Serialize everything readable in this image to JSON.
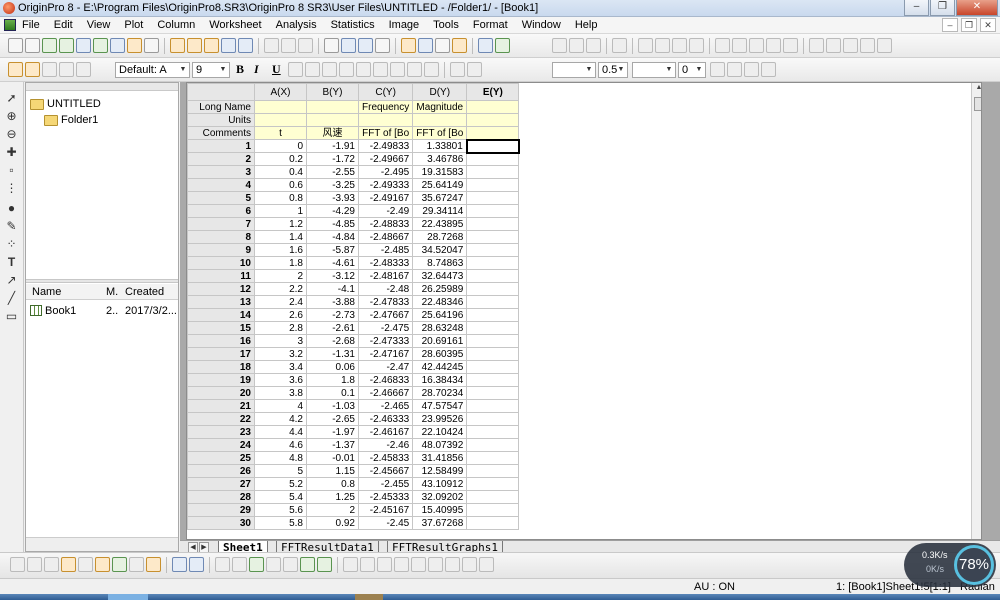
{
  "window": {
    "title": "OriginPro 8 - E:\\Program Files\\OriginPro8.SR3\\OriginPro 8 SR3\\User Files\\UNTITLED - /Folder1/ - [Book1]"
  },
  "menu": [
    "File",
    "Edit",
    "View",
    "Plot",
    "Column",
    "Worksheet",
    "Analysis",
    "Statistics",
    "Image",
    "Tools",
    "Format",
    "Window",
    "Help"
  ],
  "format_toolbar": {
    "font_name": "Default: A",
    "font_size": "9",
    "bold": "B",
    "italic": "I",
    "underline": "U",
    "line_width": "0.5",
    "pattern_value": "0"
  },
  "explorer": {
    "root": "UNTITLED",
    "folder": "Folder1",
    "columns": [
      "Name",
      "M.",
      "Created"
    ],
    "items": [
      {
        "name": "Book1",
        "m": "2..",
        "created": "2017/3/2..."
      }
    ]
  },
  "worksheet": {
    "columns": [
      "A(X)",
      "B(Y)",
      "C(Y)",
      "D(Y)",
      "E(Y)"
    ],
    "label_rows": [
      {
        "label": "Long Name",
        "cells": [
          "",
          "",
          "Frequency",
          "Magnitude",
          ""
        ]
      },
      {
        "label": "Units",
        "cells": [
          "",
          "",
          "",
          "",
          ""
        ]
      },
      {
        "label": "Comments",
        "cells": [
          "t",
          "风速",
          "FFT of [Bo",
          "FFT of [Bo",
          ""
        ]
      }
    ],
    "rows": [
      [
        "1",
        "0",
        "-1.91",
        "-2.49833",
        "1.33801"
      ],
      [
        "2",
        "0.2",
        "-1.72",
        "-2.49667",
        "3.46786"
      ],
      [
        "3",
        "0.4",
        "-2.55",
        "-2.495",
        "19.31583"
      ],
      [
        "4",
        "0.6",
        "-3.25",
        "-2.49333",
        "25.64149"
      ],
      [
        "5",
        "0.8",
        "-3.93",
        "-2.49167",
        "35.67247"
      ],
      [
        "6",
        "1",
        "-4.29",
        "-2.49",
        "29.34114"
      ],
      [
        "7",
        "1.2",
        "-4.85",
        "-2.48833",
        "22.43895"
      ],
      [
        "8",
        "1.4",
        "-4.84",
        "-2.48667",
        "28.7268"
      ],
      [
        "9",
        "1.6",
        "-5.87",
        "-2.485",
        "34.52047"
      ],
      [
        "10",
        "1.8",
        "-4.61",
        "-2.48333",
        "8.74863"
      ],
      [
        "11",
        "2",
        "-3.12",
        "-2.48167",
        "32.64473"
      ],
      [
        "12",
        "2.2",
        "-4.1",
        "-2.48",
        "26.25989"
      ],
      [
        "13",
        "2.4",
        "-3.88",
        "-2.47833",
        "22.48346"
      ],
      [
        "14",
        "2.6",
        "-2.73",
        "-2.47667",
        "25.64196"
      ],
      [
        "15",
        "2.8",
        "-2.61",
        "-2.475",
        "28.63248"
      ],
      [
        "16",
        "3",
        "-2.68",
        "-2.47333",
        "20.69161"
      ],
      [
        "17",
        "3.2",
        "-1.31",
        "-2.47167",
        "28.60395"
      ],
      [
        "18",
        "3.4",
        "0.06",
        "-2.47",
        "42.44245"
      ],
      [
        "19",
        "3.6",
        "1.8",
        "-2.46833",
        "16.38434"
      ],
      [
        "20",
        "3.8",
        "0.1",
        "-2.46667",
        "28.70234"
      ],
      [
        "21",
        "4",
        "-1.03",
        "-2.465",
        "47.57547"
      ],
      [
        "22",
        "4.2",
        "-2.65",
        "-2.46333",
        "23.99526"
      ],
      [
        "23",
        "4.4",
        "-1.97",
        "-2.46167",
        "22.10424"
      ],
      [
        "24",
        "4.6",
        "-1.37",
        "-2.46",
        "48.07392"
      ],
      [
        "25",
        "4.8",
        "-0.01",
        "-2.45833",
        "31.41856"
      ],
      [
        "26",
        "5",
        "1.15",
        "-2.45667",
        "12.58499"
      ],
      [
        "27",
        "5.2",
        "0.8",
        "-2.455",
        "43.10912"
      ],
      [
        "28",
        "5.4",
        "1.25",
        "-2.45333",
        "32.09202"
      ],
      [
        "29",
        "5.6",
        "2",
        "-2.45167",
        "15.40995"
      ],
      [
        "30",
        "5.8",
        "0.92",
        "-2.45",
        "37.67268"
      ]
    ],
    "tabs": [
      "Sheet1",
      "FFTResultData1",
      "FFTResultGraphs1"
    ]
  },
  "status": {
    "au": "AU : ON",
    "location": "1: [Book1]Sheet1!5[1:1]",
    "angle": "Radian"
  },
  "netmeter": {
    "speed_up": "0.3K/s",
    "speed_down": "0K/s",
    "percent": "78%"
  }
}
